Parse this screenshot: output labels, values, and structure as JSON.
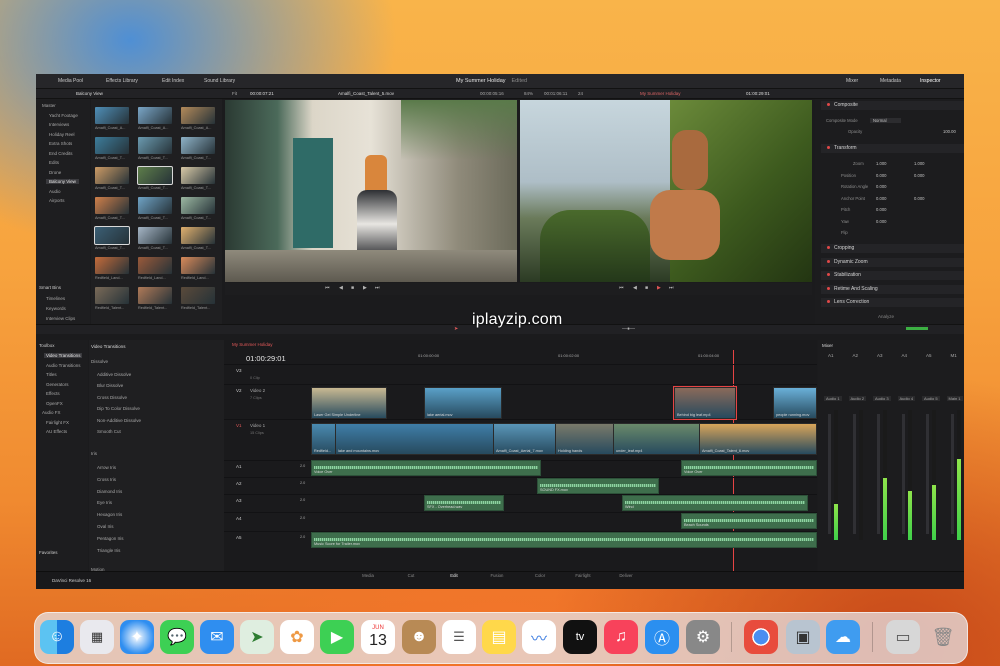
{
  "watermark": "iplayzip.com",
  "topbar": {
    "tabs": [
      "Media Pool",
      "Effects Library",
      "Edit Index",
      "Sound Library"
    ],
    "project_title": "My Summer Holiday",
    "project_status": "Edited",
    "right_tabs": [
      "Mixer",
      "Metadata",
      "Inspector"
    ]
  },
  "mediapool": {
    "bin_label": "Balcony View",
    "bins": [
      "Master",
      "Yacht Footage",
      "Interviews",
      "Holiday Reel",
      "Extra Shots",
      "End Credits",
      "Edits",
      "Drone",
      "Balcony View",
      "Audio",
      "Airports"
    ],
    "smart_bins_title": "Smart Bins",
    "smart_bins": [
      "Timelines",
      "Keywords",
      "Interview Clips"
    ],
    "clips": [
      "Amalfi_Coast_A...",
      "Amalfi_Coast_A...",
      "Amalfi_Coast_A...",
      "Amalfi_Coast_T...",
      "Amalfi_Coast_T...",
      "Amalfi_Coast_T...",
      "Amalfi_Coast_T...",
      "Amalfi_Coast_T...",
      "Amalfi_Coast_T...",
      "Amalfi_Coast_T...",
      "Amalfi_Coast_T...",
      "Amalfi_Coast_T...",
      "Amalfi_Coast_T...",
      "Amalfi_Coast_T...",
      "Amalfi_Coast_T...",
      "Redfield_Land...",
      "Redfield_Land...",
      "Redfield_Land...",
      "Redfield_Talent...",
      "Redfield_Talent...",
      "Redfield_Talent..."
    ]
  },
  "viewer": {
    "fit": "Fit",
    "src_tc": "00:00:07:21",
    "src_clip": "Amalfi_Coast_Talent_5.mov",
    "src_dur": "00:00:05:16",
    "zoom": "84%",
    "prog_tc": "00:01:06:11",
    "fps": "24",
    "prog_timeline": "My Summer Holiday",
    "prog_tc2": "01:00:29:01"
  },
  "inspector": {
    "composite_title": "Composite",
    "composite_mode_label": "Composite Mode",
    "composite_mode": "Normal",
    "opacity_label": "Opacity",
    "opacity": "100.00",
    "transform_title": "Transform",
    "rows": [
      {
        "label": "Zoom",
        "x": "1.000",
        "y": "1.000"
      },
      {
        "label": "Position",
        "x": "0.000",
        "y": "0.000"
      },
      {
        "label": "Rotation Angle",
        "x": "0.000"
      },
      {
        "label": "Anchor Point",
        "x": "0.000",
        "y": "0.000"
      },
      {
        "label": "Pitch",
        "x": "0.000"
      },
      {
        "label": "Yaw",
        "x": "0.000"
      },
      {
        "label": "Flip",
        "x": ""
      }
    ],
    "sections": [
      "Cropping",
      "Dynamic Zoom",
      "Stabilization",
      "Retime And Scaling",
      "Lens Correction"
    ],
    "analyze": "Analyze"
  },
  "toolbox": {
    "title": "Toolbox",
    "items": [
      "Video Transitions",
      "Audio Transitions",
      "Titles",
      "Generators",
      "Effects",
      "OpenFX",
      "Audio FX",
      "Fairlight FX",
      "AU Effects"
    ],
    "favorites": "Favorites",
    "panel_title": "Video Transitions",
    "dissolve_header": "Dissolve",
    "dissolve": [
      "Additive Dissolve",
      "Blur Dissolve",
      "Cross Dissolve",
      "Dip To Color Dissolve",
      "Non-Additive Dissolve",
      "Smooth Cut"
    ],
    "iris_header": "Iris",
    "iris": [
      "Arrow Iris",
      "Cross Iris",
      "Diamond Iris",
      "Eye Iris",
      "Hexagon Iris",
      "Oval Iris",
      "Pentagon Iris",
      "Triangle Iris"
    ],
    "motion_header": "Motion"
  },
  "timeline": {
    "tab": "My Summer Holiday",
    "timecode": "01:00:29:01",
    "ruler": [
      "01:00:00:00",
      "01:00:02:00",
      "01:00:04:00",
      "01:00:06:00"
    ],
    "tracks": [
      {
        "id": "V3",
        "name": "",
        "note": "0 Clip"
      },
      {
        "id": "V2",
        "name": "Video 2",
        "note": "7 Clips"
      },
      {
        "id": "V1",
        "name": "Video 1",
        "note": "15 Clips"
      },
      {
        "id": "A1",
        "name": "",
        "vol": "2.0"
      },
      {
        "id": "A2",
        "name": "",
        "vol": "2.0"
      },
      {
        "id": "A3",
        "name": "",
        "vol": "2.0"
      },
      {
        "id": "A4",
        "name": "",
        "vol": "2.0"
      },
      {
        "id": "A5",
        "name": "",
        "vol": "2.0"
      }
    ],
    "v2_clips": [
      "Laser Gel Simple Underline",
      "lake aerial.mov",
      "Behind big leaf.mp4",
      "people running.mov"
    ],
    "v1_clips": [
      "Redfield...",
      "lake and mountains.mov",
      "Amalfi_Coast_Aerial_7.mov",
      "Holding hands",
      "under_leaf.mp4",
      "Amalfi_Coast_Talent_6.mov"
    ],
    "a1_clips": [
      "Voice Over",
      "Voice Over"
    ],
    "a2_clips": [
      "SOUND FX.mov"
    ],
    "a3_clips": [
      "SFX - Overhead.wav",
      "Wind"
    ],
    "a4_clips": [
      "Beach Sounds"
    ],
    "a5_clips": [
      "Music Score for Trailer.mov"
    ]
  },
  "mixer": {
    "title": "Mixer",
    "channels": [
      "A1",
      "A2",
      "A3",
      "A4",
      "A5",
      "M1"
    ],
    "buses": [
      "Audio 1",
      "Audio 2",
      "Audio 3",
      "Audio 4",
      "Audio 5",
      "Main 1"
    ],
    "levels": [
      0.28,
      0.0,
      0.48,
      0.38,
      0.42,
      0.62
    ]
  },
  "pages": {
    "items": [
      "Media",
      "Cut",
      "Edit",
      "Fusion",
      "Color",
      "Fairlight",
      "Deliver"
    ],
    "active": "Edit"
  },
  "brand": "DaVinci Resolve 16",
  "dock": {
    "calendar_month": "JUN",
    "calendar_day": "13",
    "tv_label": "tv"
  },
  "colors": {
    "accent": "#e64444",
    "audio_clip": "#3e6e4c",
    "video_clip": "#3f7ea8"
  }
}
